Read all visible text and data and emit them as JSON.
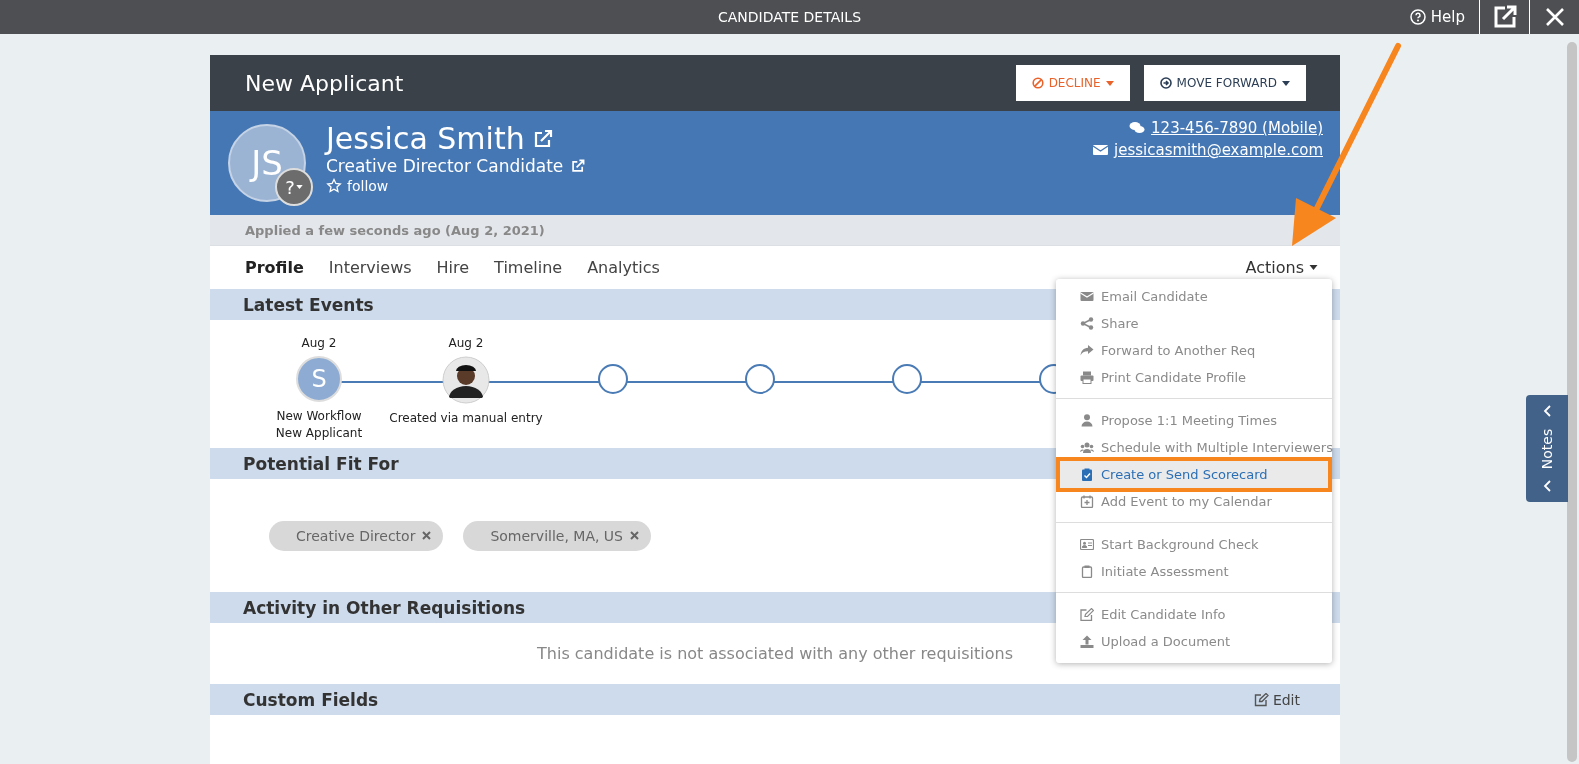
{
  "top_bar": {
    "title": "CANDIDATE DETAILS",
    "help": "Help"
  },
  "header": {
    "stage": "New Applicant",
    "decline": "DECLINE",
    "move_forward": "MOVE FORWARD"
  },
  "candidate": {
    "initials": "JS",
    "status_badge": "?",
    "name": "Jessica Smith",
    "position": "Creative Director Candidate",
    "follow": "follow",
    "phone": "123-456-7890 (Mobile)",
    "email": "jessicasmith@example.com"
  },
  "applied": "Applied a few seconds ago (Aug 2, 2021)",
  "tabs": [
    {
      "label": "Profile",
      "selected": true
    },
    {
      "label": "Interviews",
      "selected": false
    },
    {
      "label": "Hire",
      "selected": false
    },
    {
      "label": "Timeline",
      "selected": false
    },
    {
      "label": "Analytics",
      "selected": false
    }
  ],
  "actions": {
    "label": "Actions",
    "menu": [
      [
        {
          "label": "Email Candidate",
          "highlighted": false
        },
        {
          "label": "Share",
          "highlighted": false
        },
        {
          "label": "Forward to Another Req",
          "highlighted": false
        },
        {
          "label": "Print Candidate Profile",
          "highlighted": false
        }
      ],
      [
        {
          "label": "Propose 1:1 Meeting Times",
          "highlighted": false
        },
        {
          "label": "Schedule with Multiple Interviewers",
          "highlighted": false
        },
        {
          "label": "Create or Send Scorecard",
          "highlighted": true
        },
        {
          "label": "Add Event to my Calendar",
          "highlighted": false
        }
      ],
      [
        {
          "label": "Start Background Check",
          "highlighted": false
        },
        {
          "label": "Initiate Assessment",
          "highlighted": false
        }
      ],
      [
        {
          "label": "Edit Candidate Info",
          "highlighted": false
        },
        {
          "label": "Upload a Document",
          "highlighted": false
        }
      ]
    ]
  },
  "latest_events": {
    "title": "Latest Events",
    "events": [
      {
        "kind": "initial",
        "date": "Aug 2",
        "initial": "S",
        "lines": [
          "New Workflow",
          "New Applicant"
        ]
      },
      {
        "kind": "photo",
        "date": "Aug 2",
        "lines": [
          "Created via manual entry"
        ]
      },
      {
        "kind": "empty"
      },
      {
        "kind": "empty"
      },
      {
        "kind": "empty"
      },
      {
        "kind": "empty"
      }
    ]
  },
  "potential_fit": {
    "title": "Potential Fit For",
    "tags": [
      "Creative Director",
      "Somerville, MA, US"
    ]
  },
  "other_requisitions": {
    "title": "Activity in Other Requisitions",
    "message": "This candidate is not associated with any other requisitions"
  },
  "custom_fields": {
    "title": "Custom Fields",
    "edit": "Edit"
  },
  "notes_tab": "Notes"
}
